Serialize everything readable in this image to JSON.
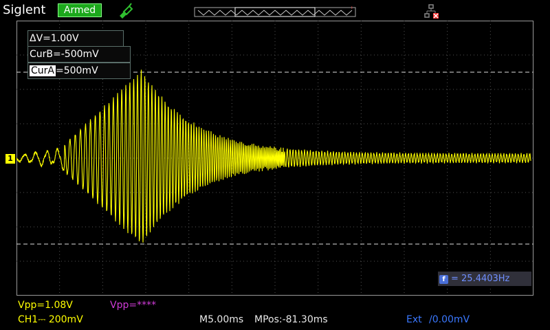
{
  "header": {
    "brand": "Siglent",
    "status": "Armed",
    "icons": [
      "probe-icon",
      "memory-strip-icon",
      "usb-disconnected-icon",
      "trigger-marker-icon"
    ],
    "trigger_marker": "T"
  },
  "cursors": {
    "delta": "ΔV=1.00V",
    "curB": "CurB=-500mV",
    "curA_name": "CurA",
    "curA_value": "=500mV"
  },
  "channel_marker": "1",
  "frequency": {
    "icon_label": "f",
    "value": "= 25.4403Hz"
  },
  "footer": {
    "vpp1": "Vpp=1.08V",
    "vpp2": "Vpp=****",
    "ch1": "CH1⎓ 200mV",
    "timebase": "M5.00ms",
    "mpos": "MPos:-81.30ms",
    "trigger_source": "Ext",
    "trigger_level": "0.00mV"
  },
  "colors": {
    "trace": "#ffff00",
    "status_bg": "#1ca81c",
    "freq_text": "#6f8fff"
  }
}
